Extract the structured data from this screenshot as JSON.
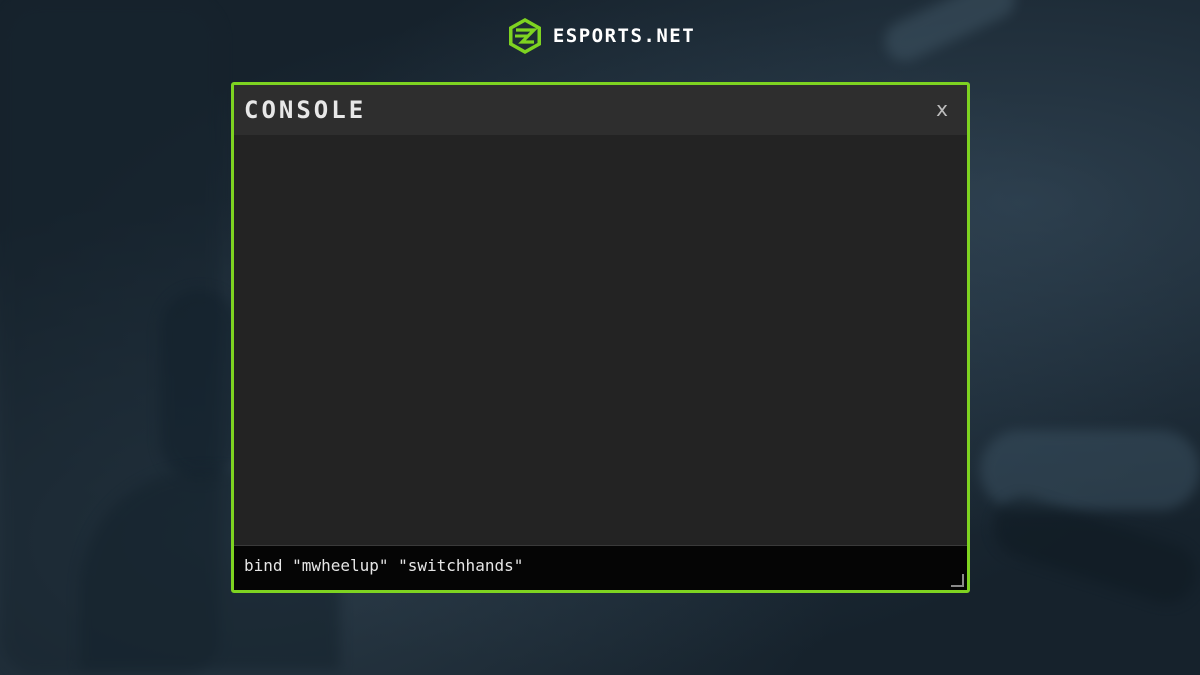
{
  "logo": {
    "text": "ESPORTS.NET",
    "icon": "esports-logo-icon",
    "accent_color": "#7ed321"
  },
  "console": {
    "title": "CONSOLE",
    "close_label": "x",
    "input_value": "bind \"mwheelup\" \"switchhands\"",
    "border_color": "#7ed321"
  }
}
